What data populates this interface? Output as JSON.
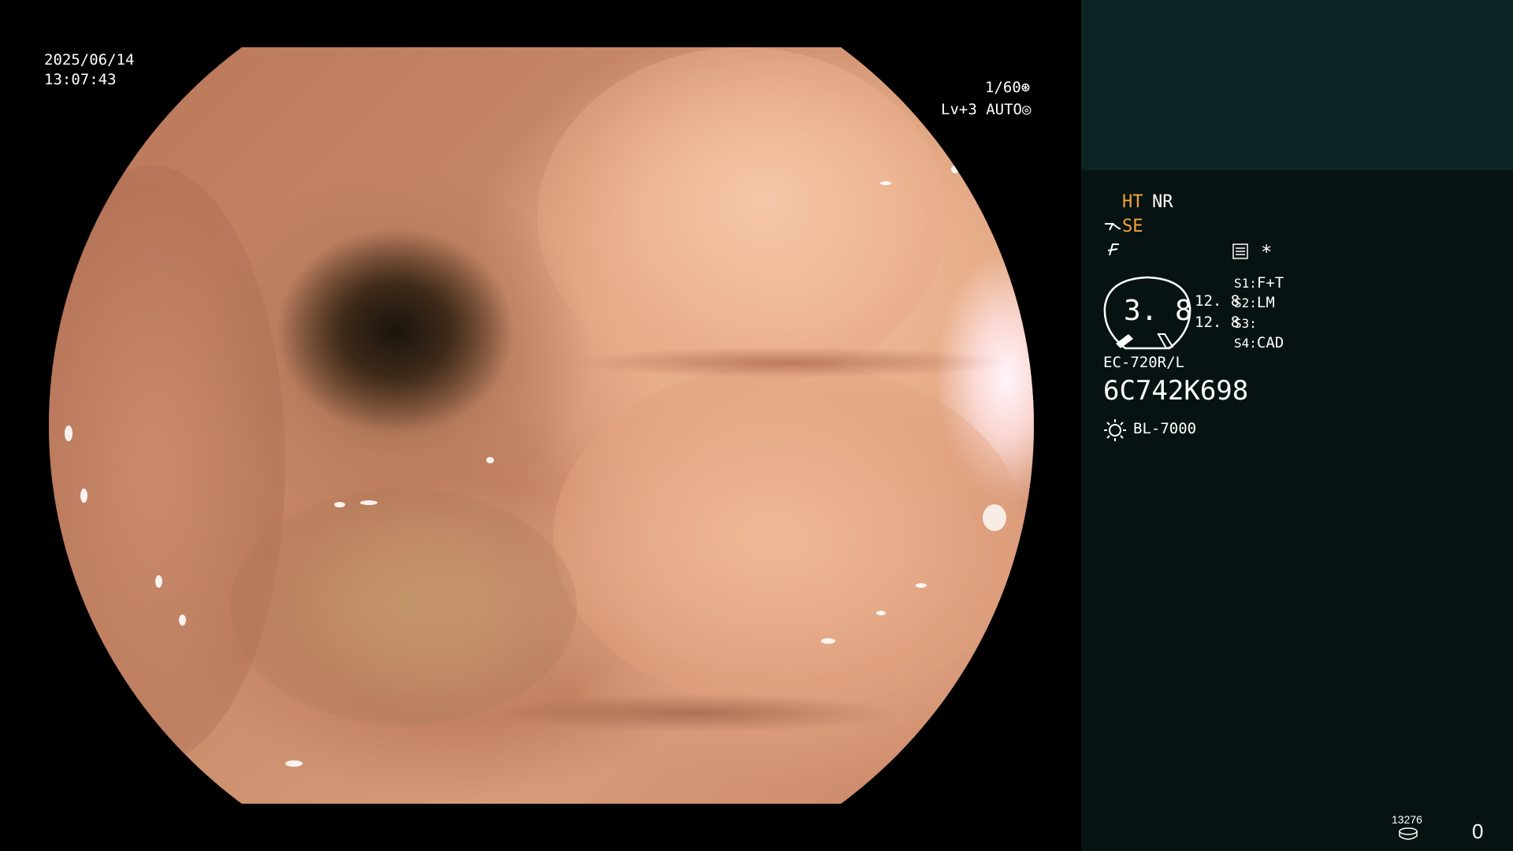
{
  "scope": {
    "date": "2025/06/14",
    "time": "13:07:43",
    "shutter": "1/60",
    "level": "Lv+3",
    "mode": "AUTO"
  },
  "panel": {
    "ht": "HT",
    "nr": "NR",
    "se": "SE",
    "asterisk": "*",
    "zoom_value": "3. 8",
    "value_a": "12. 8",
    "value_b": "12. 8",
    "switches": [
      {
        "key": "S1:",
        "value": "F+T"
      },
      {
        "key": "S2:",
        "value": "LM"
      },
      {
        "key": "S3:",
        "value": ""
      },
      {
        "key": "S4:",
        "value": "CAD"
      }
    ],
    "scope_model": "EC-720R/L",
    "serial": "6C742K698",
    "light_source": "BL-7000",
    "counter": "13276",
    "count": "0"
  },
  "colors": {
    "panel_bg": "#071312",
    "panel_top_bg": "#0d2424",
    "accent_orange": "#f3a63c"
  }
}
